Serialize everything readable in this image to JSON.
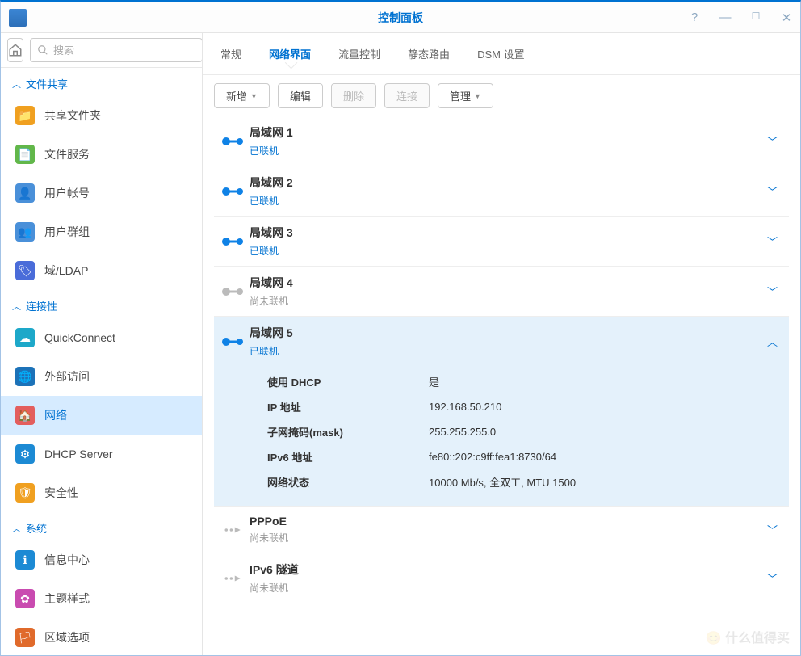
{
  "title": "控制面板",
  "search_placeholder": "搜索",
  "sidebar": {
    "groups": [
      {
        "label": "文件共享",
        "items": [
          {
            "label": "共享文件夹",
            "color": "#f0a020",
            "icon": "📁"
          },
          {
            "label": "文件服务",
            "color": "#62b74a",
            "icon": "📄"
          },
          {
            "label": "用户帐号",
            "color": "#4a90d9",
            "icon": "👤"
          },
          {
            "label": "用户群组",
            "color": "#4a90d9",
            "icon": "👥"
          },
          {
            "label": "域/LDAP",
            "color": "#4a6cd9",
            "icon": "🏷"
          }
        ]
      },
      {
        "label": "连接性",
        "items": [
          {
            "label": "QuickConnect",
            "color": "#1da8c9",
            "icon": "☁"
          },
          {
            "label": "外部访问",
            "color": "#1c72b8",
            "icon": "🌐"
          },
          {
            "label": "网络",
            "active": true,
            "color": "#e35e5e",
            "icon": "🏠"
          },
          {
            "label": "DHCP Server",
            "color": "#1c8ad4",
            "icon": "⚙"
          },
          {
            "label": "安全性",
            "color": "#f0a020",
            "icon": "🛡"
          }
        ]
      },
      {
        "label": "系统",
        "items": [
          {
            "label": "信息中心",
            "color": "#1c8ad4",
            "icon": "ℹ"
          },
          {
            "label": "主题样式",
            "color": "#c94bb0",
            "icon": "✿"
          },
          {
            "label": "区域选项",
            "color": "#e06a2b",
            "icon": "🏳"
          }
        ]
      }
    ]
  },
  "tabs": [
    "常规",
    "网络界面",
    "流量控制",
    "静态路由",
    "DSM 设置"
  ],
  "active_tab": 1,
  "toolbar": {
    "add": "新增",
    "edit": "编辑",
    "delete": "删除",
    "connect": "连接",
    "manage": "管理"
  },
  "interfaces": [
    {
      "name": "局域网 1",
      "status": "已联机",
      "on": true
    },
    {
      "name": "局域网 2",
      "status": "已联机",
      "on": true
    },
    {
      "name": "局域网 3",
      "status": "已联机",
      "on": true
    },
    {
      "name": "局域网 4",
      "status": "尚未联机",
      "on": false
    },
    {
      "name": "局域网 5",
      "status": "已联机",
      "on": true,
      "expanded": true,
      "details": [
        {
          "k": "使用 DHCP",
          "v": "是"
        },
        {
          "k": "IP 地址",
          "v": "192.168.50.210"
        },
        {
          "k": "子网掩码(mask)",
          "v": "255.255.255.0"
        },
        {
          "k": "IPv6 地址",
          "v": "fe80::202:c9ff:fea1:8730/64"
        },
        {
          "k": "网络状态",
          "v": "10000 Mb/s, 全双工, MTU 1500"
        }
      ]
    },
    {
      "name": "PPPoE",
      "status": "尚未联机",
      "on": false,
      "arrow": true
    },
    {
      "name": "IPv6 隧道",
      "status": "尚未联机",
      "on": false,
      "arrow": true
    }
  ],
  "watermark": "什么值得买"
}
